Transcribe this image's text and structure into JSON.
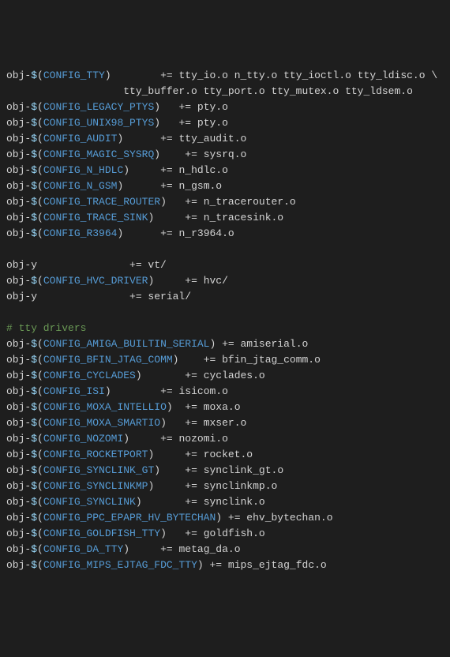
{
  "lines": [
    [
      {
        "cls": "t-default",
        "text": "obj-"
      },
      {
        "cls": "t-var",
        "text": "$"
      },
      {
        "cls": "t-paren",
        "text": "("
      },
      {
        "cls": "t-config",
        "text": "CONFIG_TTY"
      },
      {
        "cls": "t-paren",
        "text": ")"
      },
      {
        "cls": "t-default",
        "text": "        += tty_io.o n_tty.o tty_ioctl.o tty_ldisc.o \\"
      }
    ],
    [
      {
        "cls": "t-default",
        "text": "                   tty_buffer.o tty_port.o tty_mutex.o tty_ldsem.o"
      }
    ],
    [
      {
        "cls": "t-default",
        "text": "obj-"
      },
      {
        "cls": "t-var",
        "text": "$"
      },
      {
        "cls": "t-paren",
        "text": "("
      },
      {
        "cls": "t-config",
        "text": "CONFIG_LEGACY_PTYS"
      },
      {
        "cls": "t-paren",
        "text": ")"
      },
      {
        "cls": "t-default",
        "text": "   += pty.o"
      }
    ],
    [
      {
        "cls": "t-default",
        "text": "obj-"
      },
      {
        "cls": "t-var",
        "text": "$"
      },
      {
        "cls": "t-paren",
        "text": "("
      },
      {
        "cls": "t-config",
        "text": "CONFIG_UNIX98_PTYS"
      },
      {
        "cls": "t-paren",
        "text": ")"
      },
      {
        "cls": "t-default",
        "text": "   += pty.o"
      }
    ],
    [
      {
        "cls": "t-default",
        "text": "obj-"
      },
      {
        "cls": "t-var",
        "text": "$"
      },
      {
        "cls": "t-paren",
        "text": "("
      },
      {
        "cls": "t-config",
        "text": "CONFIG_AUDIT"
      },
      {
        "cls": "t-paren",
        "text": ")"
      },
      {
        "cls": "t-default",
        "text": "      += tty_audit.o"
      }
    ],
    [
      {
        "cls": "t-default",
        "text": "obj-"
      },
      {
        "cls": "t-var",
        "text": "$"
      },
      {
        "cls": "t-paren",
        "text": "("
      },
      {
        "cls": "t-config",
        "text": "CONFIG_MAGIC_SYSRQ"
      },
      {
        "cls": "t-paren",
        "text": ")"
      },
      {
        "cls": "t-default",
        "text": "    += sysrq.o"
      }
    ],
    [
      {
        "cls": "t-default",
        "text": "obj-"
      },
      {
        "cls": "t-var",
        "text": "$"
      },
      {
        "cls": "t-paren",
        "text": "("
      },
      {
        "cls": "t-config",
        "text": "CONFIG_N_HDLC"
      },
      {
        "cls": "t-paren",
        "text": ")"
      },
      {
        "cls": "t-default",
        "text": "     += n_hdlc.o"
      }
    ],
    [
      {
        "cls": "t-default",
        "text": "obj-"
      },
      {
        "cls": "t-var",
        "text": "$"
      },
      {
        "cls": "t-paren",
        "text": "("
      },
      {
        "cls": "t-config",
        "text": "CONFIG_N_GSM"
      },
      {
        "cls": "t-paren",
        "text": ")"
      },
      {
        "cls": "t-default",
        "text": "      += n_gsm.o"
      }
    ],
    [
      {
        "cls": "t-default",
        "text": "obj-"
      },
      {
        "cls": "t-var",
        "text": "$"
      },
      {
        "cls": "t-paren",
        "text": "("
      },
      {
        "cls": "t-config",
        "text": "CONFIG_TRACE_ROUTER"
      },
      {
        "cls": "t-paren",
        "text": ")"
      },
      {
        "cls": "t-default",
        "text": "   += n_tracerouter.o"
      }
    ],
    [
      {
        "cls": "t-default",
        "text": "obj-"
      },
      {
        "cls": "t-var",
        "text": "$"
      },
      {
        "cls": "t-paren",
        "text": "("
      },
      {
        "cls": "t-config",
        "text": "CONFIG_TRACE_SINK"
      },
      {
        "cls": "t-paren",
        "text": ")"
      },
      {
        "cls": "t-default",
        "text": "     += n_tracesink.o"
      }
    ],
    [
      {
        "cls": "t-default",
        "text": "obj-"
      },
      {
        "cls": "t-var",
        "text": "$"
      },
      {
        "cls": "t-paren",
        "text": "("
      },
      {
        "cls": "t-config",
        "text": "CONFIG_R3964"
      },
      {
        "cls": "t-paren",
        "text": ")"
      },
      {
        "cls": "t-default",
        "text": "      += n_r3964.o"
      }
    ],
    [],
    [
      {
        "cls": "t-default",
        "text": "obj-y               += vt/"
      }
    ],
    [
      {
        "cls": "t-default",
        "text": "obj-"
      },
      {
        "cls": "t-var",
        "text": "$"
      },
      {
        "cls": "t-paren",
        "text": "("
      },
      {
        "cls": "t-config",
        "text": "CONFIG_HVC_DRIVER"
      },
      {
        "cls": "t-paren",
        "text": ")"
      },
      {
        "cls": "t-default",
        "text": "     += hvc/"
      }
    ],
    [
      {
        "cls": "t-default",
        "text": "obj-y               += serial/"
      }
    ],
    [],
    [
      {
        "cls": "t-comment",
        "text": "# tty drivers"
      }
    ],
    [
      {
        "cls": "t-default",
        "text": "obj-"
      },
      {
        "cls": "t-var",
        "text": "$"
      },
      {
        "cls": "t-paren",
        "text": "("
      },
      {
        "cls": "t-config",
        "text": "CONFIG_AMIGA_BUILTIN_SERIAL"
      },
      {
        "cls": "t-paren",
        "text": ")"
      },
      {
        "cls": "t-default",
        "text": " += amiserial.o"
      }
    ],
    [
      {
        "cls": "t-default",
        "text": "obj-"
      },
      {
        "cls": "t-var",
        "text": "$"
      },
      {
        "cls": "t-paren",
        "text": "("
      },
      {
        "cls": "t-config",
        "text": "CONFIG_BFIN_JTAG_COMM"
      },
      {
        "cls": "t-paren",
        "text": ")"
      },
      {
        "cls": "t-default",
        "text": "    += bfin_jtag_comm.o"
      }
    ],
    [
      {
        "cls": "t-default",
        "text": "obj-"
      },
      {
        "cls": "t-var",
        "text": "$"
      },
      {
        "cls": "t-paren",
        "text": "("
      },
      {
        "cls": "t-config",
        "text": "CONFIG_CYCLADES"
      },
      {
        "cls": "t-paren",
        "text": ")"
      },
      {
        "cls": "t-default",
        "text": "       += cyclades.o"
      }
    ],
    [
      {
        "cls": "t-default",
        "text": "obj-"
      },
      {
        "cls": "t-var",
        "text": "$"
      },
      {
        "cls": "t-paren",
        "text": "("
      },
      {
        "cls": "t-config",
        "text": "CONFIG_ISI"
      },
      {
        "cls": "t-paren",
        "text": ")"
      },
      {
        "cls": "t-default",
        "text": "        += isicom.o"
      }
    ],
    [
      {
        "cls": "t-default",
        "text": "obj-"
      },
      {
        "cls": "t-var",
        "text": "$"
      },
      {
        "cls": "t-paren",
        "text": "("
      },
      {
        "cls": "t-config",
        "text": "CONFIG_MOXA_INTELLIO"
      },
      {
        "cls": "t-paren",
        "text": ")"
      },
      {
        "cls": "t-default",
        "text": "  += moxa.o"
      }
    ],
    [
      {
        "cls": "t-default",
        "text": "obj-"
      },
      {
        "cls": "t-var",
        "text": "$"
      },
      {
        "cls": "t-paren",
        "text": "("
      },
      {
        "cls": "t-config",
        "text": "CONFIG_MOXA_SMARTIO"
      },
      {
        "cls": "t-paren",
        "text": ")"
      },
      {
        "cls": "t-default",
        "text": "   += mxser.o"
      }
    ],
    [
      {
        "cls": "t-default",
        "text": "obj-"
      },
      {
        "cls": "t-var",
        "text": "$"
      },
      {
        "cls": "t-paren",
        "text": "("
      },
      {
        "cls": "t-config",
        "text": "CONFIG_NOZOMI"
      },
      {
        "cls": "t-paren",
        "text": ")"
      },
      {
        "cls": "t-default",
        "text": "     += nozomi.o"
      }
    ],
    [
      {
        "cls": "t-default",
        "text": "obj-"
      },
      {
        "cls": "t-var",
        "text": "$"
      },
      {
        "cls": "t-paren",
        "text": "("
      },
      {
        "cls": "t-config",
        "text": "CONFIG_ROCKETPORT"
      },
      {
        "cls": "t-paren",
        "text": ")"
      },
      {
        "cls": "t-default",
        "text": "     += rocket.o"
      }
    ],
    [
      {
        "cls": "t-default",
        "text": "obj-"
      },
      {
        "cls": "t-var",
        "text": "$"
      },
      {
        "cls": "t-paren",
        "text": "("
      },
      {
        "cls": "t-config",
        "text": "CONFIG_SYNCLINK_GT"
      },
      {
        "cls": "t-paren",
        "text": ")"
      },
      {
        "cls": "t-default",
        "text": "    += synclink_gt.o"
      }
    ],
    [
      {
        "cls": "t-default",
        "text": "obj-"
      },
      {
        "cls": "t-var",
        "text": "$"
      },
      {
        "cls": "t-paren",
        "text": "("
      },
      {
        "cls": "t-config",
        "text": "CONFIG_SYNCLINKMP"
      },
      {
        "cls": "t-paren",
        "text": ")"
      },
      {
        "cls": "t-default",
        "text": "     += synclinkmp.o"
      }
    ],
    [
      {
        "cls": "t-default",
        "text": "obj-"
      },
      {
        "cls": "t-var",
        "text": "$"
      },
      {
        "cls": "t-paren",
        "text": "("
      },
      {
        "cls": "t-config",
        "text": "CONFIG_SYNCLINK"
      },
      {
        "cls": "t-paren",
        "text": ")"
      },
      {
        "cls": "t-default",
        "text": "       += synclink.o"
      }
    ],
    [
      {
        "cls": "t-default",
        "text": "obj-"
      },
      {
        "cls": "t-var",
        "text": "$"
      },
      {
        "cls": "t-paren",
        "text": "("
      },
      {
        "cls": "t-config",
        "text": "CONFIG_PPC_EPAPR_HV_BYTECHAN"
      },
      {
        "cls": "t-paren",
        "text": ")"
      },
      {
        "cls": "t-default",
        "text": " += ehv_bytechan.o"
      }
    ],
    [
      {
        "cls": "t-default",
        "text": "obj-"
      },
      {
        "cls": "t-var",
        "text": "$"
      },
      {
        "cls": "t-paren",
        "text": "("
      },
      {
        "cls": "t-config",
        "text": "CONFIG_GOLDFISH_TTY"
      },
      {
        "cls": "t-paren",
        "text": ")"
      },
      {
        "cls": "t-default",
        "text": "   += goldfish.o"
      }
    ],
    [
      {
        "cls": "t-default",
        "text": "obj-"
      },
      {
        "cls": "t-var",
        "text": "$"
      },
      {
        "cls": "t-paren",
        "text": "("
      },
      {
        "cls": "t-config",
        "text": "CONFIG_DA_TTY"
      },
      {
        "cls": "t-paren",
        "text": ")"
      },
      {
        "cls": "t-default",
        "text": "     += metag_da.o"
      }
    ],
    [
      {
        "cls": "t-default",
        "text": "obj-"
      },
      {
        "cls": "t-var",
        "text": "$"
      },
      {
        "cls": "t-paren",
        "text": "("
      },
      {
        "cls": "t-config",
        "text": "CONFIG_MIPS_EJTAG_FDC_TTY"
      },
      {
        "cls": "t-paren",
        "text": ")"
      },
      {
        "cls": "t-default",
        "text": " += mips_ejtag_fdc.o"
      }
    ]
  ]
}
